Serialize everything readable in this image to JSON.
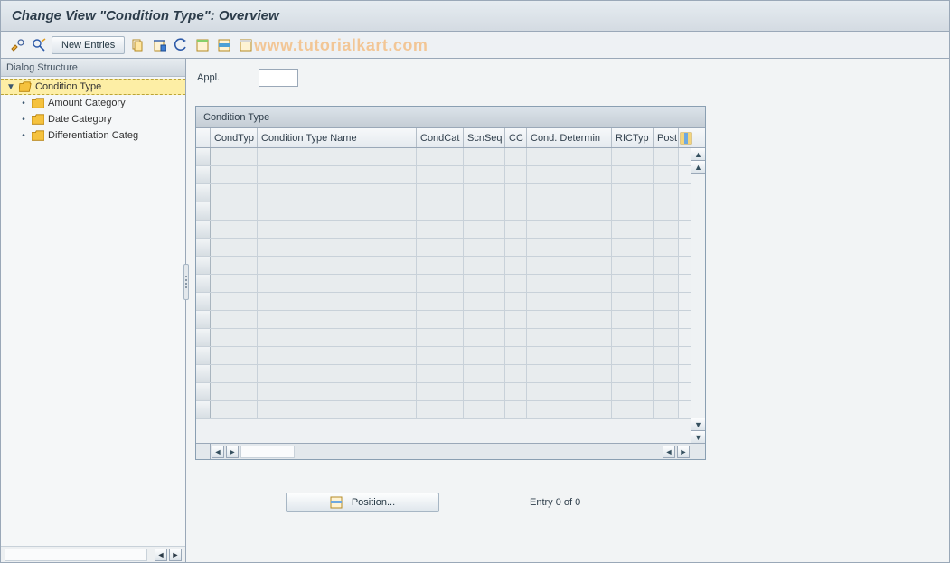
{
  "title": "Change View \"Condition Type\": Overview",
  "toolbar": {
    "new_entries_label": "New Entries"
  },
  "watermark": "www.tutorialkart.com",
  "sidebar": {
    "header": "Dialog Structure",
    "nodes": [
      {
        "label": "Condition Type",
        "selected": true,
        "open": true,
        "children": [
          {
            "label": "Amount Category"
          },
          {
            "label": "Date Category"
          },
          {
            "label": "Differentiation Categ"
          }
        ]
      }
    ]
  },
  "fields": {
    "appl_label": "Appl.",
    "appl_value": ""
  },
  "table": {
    "title": "Condition Type",
    "columns": {
      "c1": "CondTyp",
      "c2": "Condition Type Name",
      "c3": "CondCat",
      "c4": "ScnSeq",
      "c5": "CC",
      "c6": "Cond. Determin",
      "c7": "RfCTyp",
      "c8": "Post"
    },
    "row_count": 15
  },
  "footer": {
    "position_label": "Position...",
    "entry_text": "Entry 0 of 0"
  },
  "icons": {
    "toggle": "toggle-icon",
    "help": "help-icon",
    "copy": "copy-icon",
    "copy2": "copy-as-icon",
    "undo": "undo-icon",
    "sel_all": "select-all-icon",
    "sel_blk": "select-block-icon",
    "desel": "deselect-all-icon"
  }
}
